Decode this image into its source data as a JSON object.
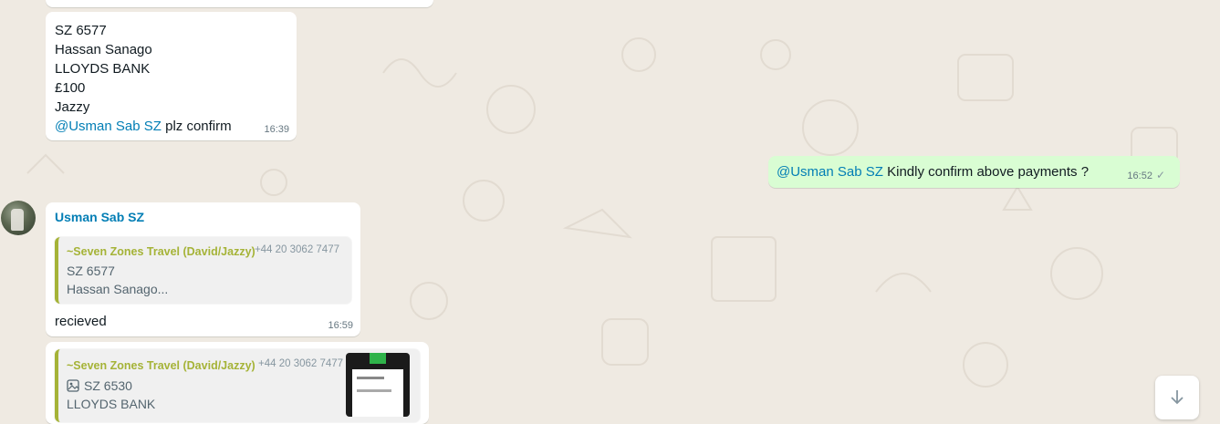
{
  "messages": {
    "partial_top": {},
    "payment_msg": {
      "lines": [
        "SZ 6577",
        "Hassan Sanago",
        "LLOYDS BANK",
        "£100",
        "Jazzy"
      ],
      "mention": "@Usman Sab SZ",
      "mention_tail": " plz confirm",
      "time": "16:39"
    },
    "outgoing": {
      "mention": "@Usman Sab SZ",
      "text": " Kindly confirm above payments ?",
      "time": "16:52",
      "tick": "✓"
    },
    "reply1": {
      "sender": "Usman Sab SZ",
      "quote_name": "~Seven Zones Travel (David/Jazzy)",
      "quote_phone": "+44 20 3062 7477",
      "quote_lines": [
        "SZ 6577",
        "Hassan Sanago..."
      ],
      "text": "recieved",
      "time": "16:59"
    },
    "reply2": {
      "quote_name": "~Seven Zones Travel (David/Jazzy)",
      "quote_phone": "+44 20 3062 7477",
      "quote_line1": "SZ 6530",
      "quote_line2": "LLOYDS BANK"
    }
  },
  "icons": {
    "image": "image-icon",
    "scroll_down": "scroll-down-icon",
    "read_tick": "check-icon"
  },
  "colors": {
    "background": "#efeae2",
    "outgoing_bubble": "#d9fdd3",
    "incoming_bubble": "#ffffff",
    "mention": "#027eb5",
    "quote_accent": "#a5b337"
  }
}
